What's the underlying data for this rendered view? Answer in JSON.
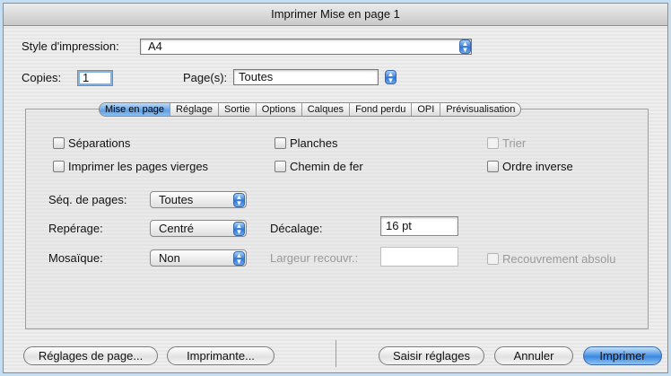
{
  "window": {
    "title": "Imprimer Mise en page 1"
  },
  "top": {
    "style_label": "Style d'impression:",
    "style_value": "A4",
    "copies_label": "Copies:",
    "copies_value": "1",
    "pages_label": "Page(s):",
    "pages_value": "Toutes"
  },
  "tabs": [
    "Mise en page",
    "Réglage",
    "Sortie",
    "Options",
    "Calques",
    "Fond perdu",
    "OPI",
    "Prévisualisation"
  ],
  "active_tab": "Mise en page",
  "panel": {
    "separations": "Séparations",
    "blank_pages": "Imprimer les pages vierges",
    "spreads": "Planches",
    "thumbnails": "Chemin de fer",
    "collate": "Trier",
    "reverse": "Ordre inverse",
    "page_seq_label": "Séq. de pages:",
    "page_seq_value": "Toutes",
    "registration_label": "Repérage:",
    "registration_value": "Centré",
    "offset_label": "Décalage:",
    "offset_value": "16 pt",
    "tiling_label": "Mosaïque:",
    "tiling_value": "Non",
    "overlap_label": "Largeur recouvr.:",
    "overlap_value": "",
    "absolute_overlap": "Recouvrement absolu"
  },
  "buttons": {
    "page_setup": "Réglages de page...",
    "printer": "Imprimante...",
    "capture": "Saisir réglages",
    "cancel": "Annuler",
    "print": "Imprimer"
  },
  "colors": {
    "accent": "#3c88e0",
    "desktop": "#c6def2"
  }
}
